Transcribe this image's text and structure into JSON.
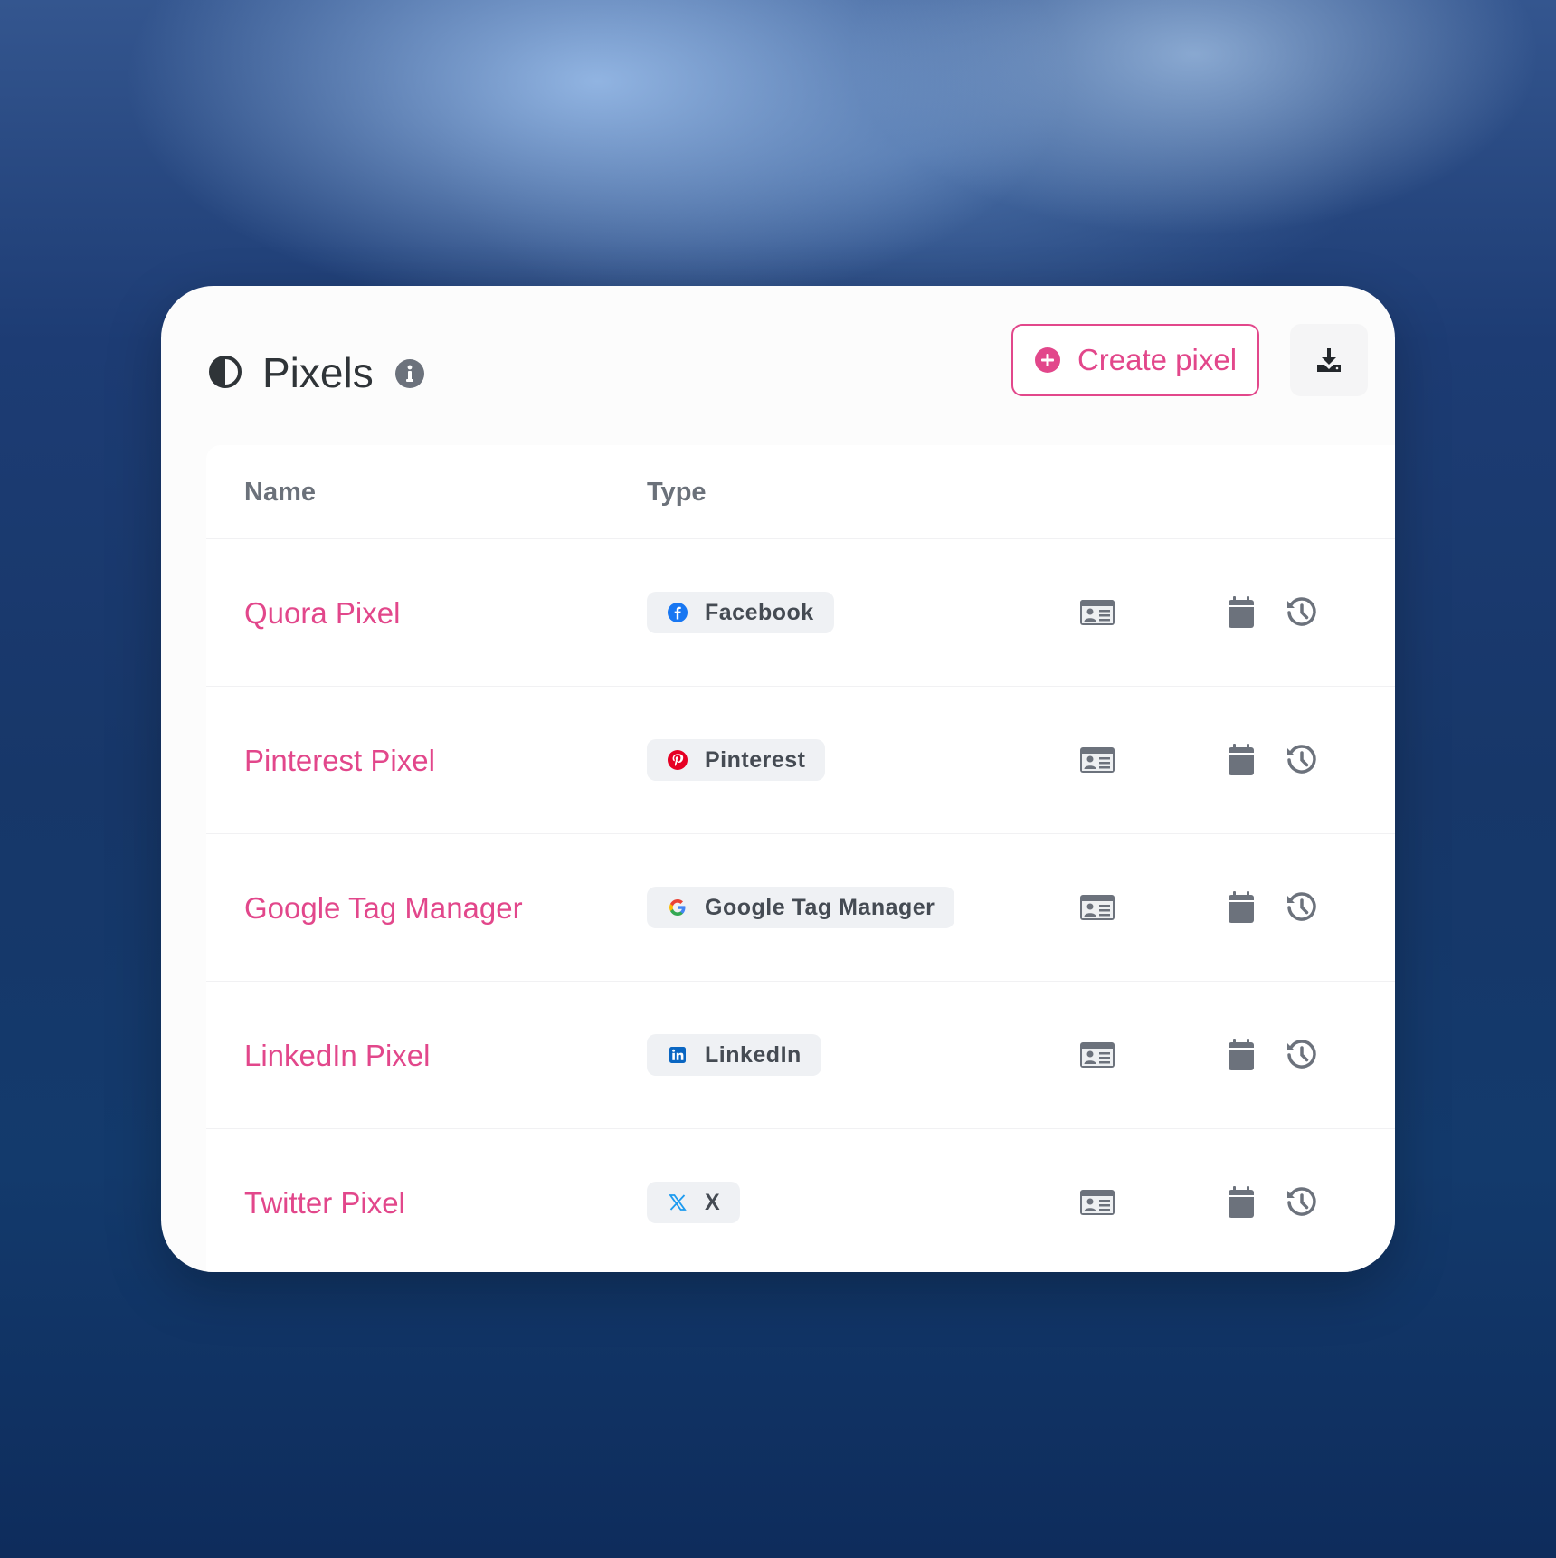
{
  "header": {
    "title": "Pixels",
    "title_icon": "adjust-half-circle-icon",
    "info_icon": "info-circle-icon",
    "create_button_label": "Create pixel",
    "create_button_icon": "plus-circle-icon",
    "download_icon": "download-icon"
  },
  "table": {
    "columns": [
      "Name",
      "Type"
    ],
    "rows": [
      {
        "name": "Quora Pixel",
        "type": "Facebook",
        "type_icon": "facebook-icon"
      },
      {
        "name": "Pinterest Pixel",
        "type": "Pinterest",
        "type_icon": "pinterest-icon"
      },
      {
        "name": "Google Tag Manager",
        "type": "Google Tag Manager",
        "type_icon": "google-icon"
      },
      {
        "name": "LinkedIn Pixel",
        "type": "LinkedIn",
        "type_icon": "linkedin-icon"
      },
      {
        "name": "Twitter Pixel",
        "type": "X",
        "type_icon": "x-twitter-icon"
      }
    ],
    "row_actions": [
      "id-card-icon",
      "calendar-icon",
      "history-icon"
    ]
  },
  "colors": {
    "accent": "#e2478b",
    "text_dark": "#2f3438",
    "text_muted": "#6b717a",
    "icon_gray": "#6c727c",
    "facebook": "#1877f2",
    "pinterest": "#e60023",
    "google": "#34a853",
    "linkedin": "#0a66c2",
    "x": "#1d9bf0"
  }
}
